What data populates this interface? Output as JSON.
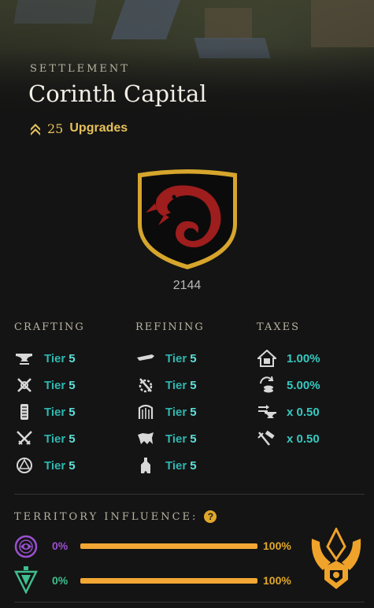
{
  "header": {
    "eyebrow": "SETTLEMENT",
    "title": "Corinth Capital",
    "upgrades_count": "25",
    "upgrades_label": "Upgrades",
    "accent_color": "#e5c05a"
  },
  "crest": {
    "icon": "red-serpent-crest",
    "id": "2144",
    "colors": {
      "field": "#0b0b0b",
      "border": "#d6a52c",
      "serpent": "#9e1d1d"
    }
  },
  "crafting": {
    "heading": "CRAFTING",
    "rows": [
      {
        "icon": "anvil-icon",
        "label": "Tier",
        "level": "5"
      },
      {
        "icon": "crossed-tools-icon",
        "label": "Tier",
        "level": "5"
      },
      {
        "icon": "scroll-icon",
        "label": "Tier",
        "level": "5"
      },
      {
        "icon": "crossed-swords-icon",
        "label": "Tier",
        "level": "5"
      },
      {
        "icon": "arcane-circle-icon",
        "label": "Tier",
        "level": "5"
      }
    ]
  },
  "refining": {
    "heading": "REFINING",
    "rows": [
      {
        "icon": "saw-icon",
        "label": "Tier",
        "level": "5"
      },
      {
        "icon": "hammer-gear-icon",
        "label": "Tier",
        "level": "5"
      },
      {
        "icon": "loom-icon",
        "label": "Tier",
        "level": "5"
      },
      {
        "icon": "tannery-icon",
        "label": "Tier",
        "level": "5"
      },
      {
        "icon": "smelter-icon",
        "label": "Tier",
        "level": "5"
      }
    ]
  },
  "taxes": {
    "heading": "TAXES",
    "rows": [
      {
        "icon": "property-tax-icon",
        "value": "1.00%"
      },
      {
        "icon": "trading-tax-icon",
        "value": "5.00%"
      },
      {
        "icon": "crafting-fee-icon",
        "value": "x 0.50"
      },
      {
        "icon": "refining-fee-icon",
        "value": "x 0.50"
      }
    ]
  },
  "influence": {
    "heading": "TERRITORY INFLUENCE:",
    "help": "?",
    "factions": [
      {
        "icon": "syndicate-faction-icon",
        "color": "#9a4fd0",
        "left_pct": "0%",
        "right_pct": "100%",
        "level": 1.0
      },
      {
        "icon": "covenant-faction-icon",
        "color": "#3fbf8e",
        "left_pct": "0%",
        "right_pct": "100%",
        "level": 1.0
      }
    ],
    "owner_icon": "marauders-faction-emblem",
    "owner_color": "#f0a32a"
  }
}
